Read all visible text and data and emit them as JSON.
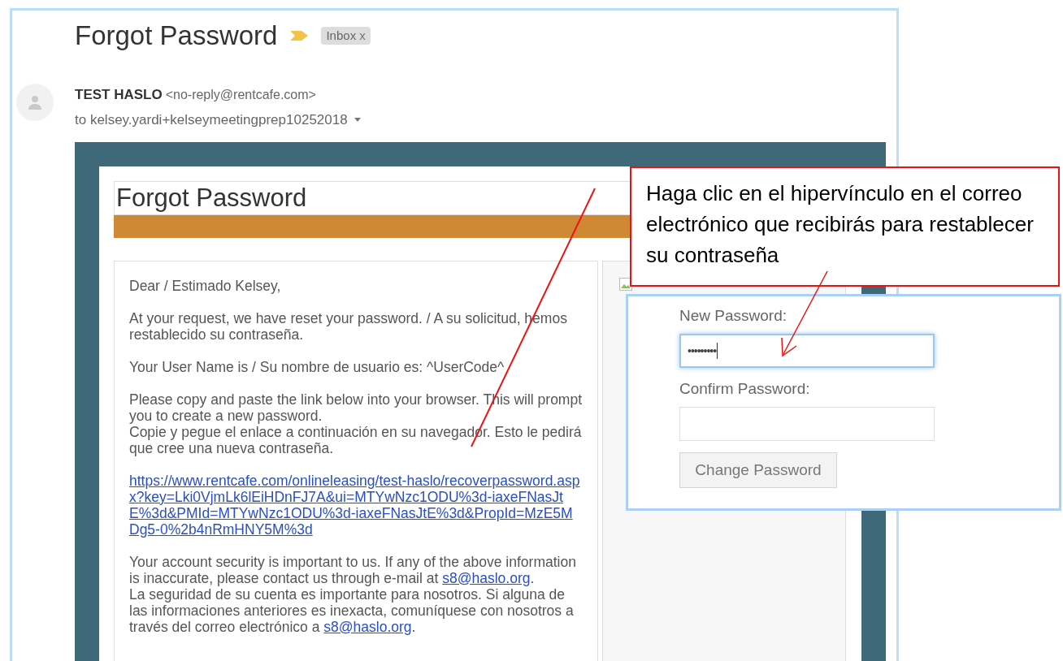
{
  "email": {
    "subject": "Forgot Password",
    "label": {
      "text": "Inbox",
      "close": "x"
    },
    "sender_name": "TEST HASLO",
    "sender_email": "<no-reply@rentcafe.com>",
    "recipient": "to kelsey.yardi+kelseymeetingprep10252018"
  },
  "message": {
    "heading": "Forgot Password",
    "paragraphs": [
      {
        "lines": [
          {
            "kind": "text",
            "text": "Dear / Estimado Kelsey,"
          }
        ]
      },
      {
        "lines": [
          {
            "kind": "text",
            "text": "At your request, we have reset your password. / A su solicitud, hemos restablecido su contraseña."
          }
        ]
      },
      {
        "lines": [
          {
            "kind": "text",
            "text": "Your User Name is /  Su nombre de usuario es:  ^UserCode^"
          }
        ]
      },
      {
        "lines": [
          {
            "kind": "text",
            "text": "Please copy and paste the link below into your browser.  This will prompt you to create a new password."
          },
          {
            "kind": "text",
            "text": "Copie y pegue el enlace a continuación en su navegador. Esto le pedirá que cree una nueva contraseña."
          }
        ]
      },
      {
        "lines": [
          {
            "kind": "link",
            "text": "https://www.rentcafe.com/onlineleasing/test-haslo/recoverpassword.aspx?key=Lki0VjmLk6lEiHDnFJ7A&ui=MTYwNzc1ODU%3d-iaxeFNasJtE%3d&PMId=MTYwNzc1ODU%3d-iaxeFNasJtE%3d&PropId=MzE5MDg5-0%2b4nRmHNY5M%3d"
          }
        ]
      },
      {
        "lines": [
          {
            "kind": "mixed",
            "parts": [
              {
                "kind": "text",
                "text": "Your account security is important to us. If any of the above information is inaccurate, please contact us through e-mail at "
              },
              {
                "kind": "link",
                "text": "s8@haslo.org"
              },
              {
                "kind": "text",
                "text": "."
              }
            ]
          },
          {
            "kind": "mixed",
            "parts": [
              {
                "kind": "text",
                "text": "La seguridad de su cuenta es importante para nosotros. Si alguna de las informaciones anteriores es inexacta, comuníquese con nosotros a través del correo electrónico a "
              },
              {
                "kind": "link",
                "text": "s8@haslo.org"
              },
              {
                "kind": "text",
                "text": "."
              }
            ]
          }
        ]
      }
    ]
  },
  "callout": {
    "text": "Haga clic en el hipervínculo en el correo electrónico que recibirás para restablecer su contraseña"
  },
  "form": {
    "fields": [
      {
        "label": "New Password:",
        "value": "•••••••••",
        "focused": true
      },
      {
        "label": "Confirm Password:",
        "focused": false
      }
    ],
    "button": "Change Password"
  }
}
